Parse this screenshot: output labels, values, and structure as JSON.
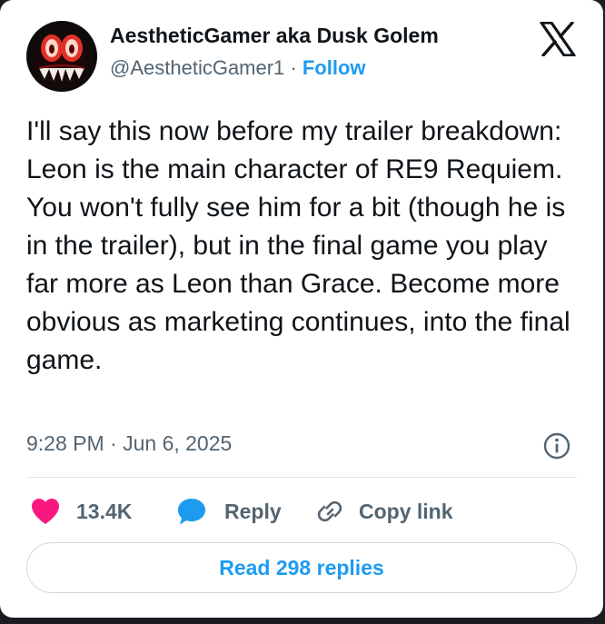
{
  "tweet": {
    "author": {
      "display_name": "AestheticGamer aka Dusk Golem",
      "handle": "@AestheticGamer1",
      "separator": " · ",
      "follow_label": "Follow",
      "avatar_icon": "monster-face-avatar"
    },
    "platform_icon": "x-logo-icon",
    "text": "I'll say this now before my trailer breakdown: Leon is the main character of RE9 Requiem. You won't fully see him for a bit (though he is in the trailer), but in the final game you play far more as Leon than Grace. Become more obvious as marketing continues, into the final game.",
    "timestamp": "9:28 PM · Jun 6, 2025",
    "info_icon": "info-icon",
    "actions": {
      "likes": "13.4K",
      "reply_label": "Reply",
      "copy_link_label": "Copy link"
    },
    "read_replies_label": "Read 298 replies"
  },
  "colors": {
    "text_primary": "#0f1419",
    "text_secondary": "#536471",
    "accent_blue": "#1d9bf0",
    "like_pink": "#f91880",
    "border": "#cfd9de"
  }
}
